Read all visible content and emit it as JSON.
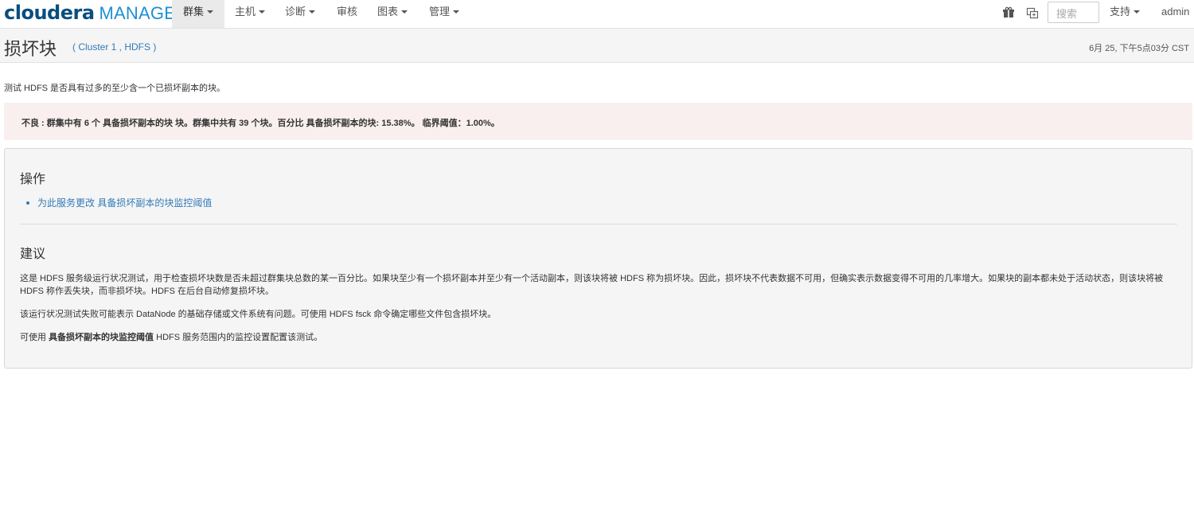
{
  "logo": {
    "brand": "cloudera",
    "product": "MANAGER"
  },
  "nav": {
    "items": [
      {
        "label": "群集",
        "dropdown": true,
        "active": true
      },
      {
        "label": "主机",
        "dropdown": true
      },
      {
        "label": "诊断",
        "dropdown": true
      },
      {
        "label": "审核",
        "dropdown": false
      },
      {
        "label": "图表",
        "dropdown": true
      },
      {
        "label": "管理",
        "dropdown": true
      }
    ],
    "icons": [
      "gift-icon",
      "parcel-icon"
    ],
    "search_placeholder": "搜索",
    "support_label": "支持",
    "user_label": "admin"
  },
  "page": {
    "title": "损坏块",
    "context": "( Cluster 1 , HDFS )",
    "timestamp": "6月 25, 下午5点03分 CST"
  },
  "description": "测试 HDFS 是否具有过多的至少含一个已损坏副本的块。",
  "alert": {
    "text": "不良 : 群集中有 6 个 具备损坏副本的块 块。群集中共有 39 个块。百分比 具备损坏副本的块: 15.38%。 临界阈值：1.00%。",
    "color": "#f9efef"
  },
  "actions": {
    "heading": "操作",
    "links": [
      "为此服务更改 具备损坏副本的块监控阈值"
    ]
  },
  "advice": {
    "heading": "建议",
    "p1": "这是 HDFS 服务级运行状况测试，用于检查损坏块数是否未超过群集块总数的某一百分比。如果块至少有一个损坏副本并至少有一个活动副本，则该块将被 HDFS 称为损坏块。因此，损坏块不代表数据不可用，但确实表示数据变得不可用的几率增大。如果块的副本都未处于活动状态，则该块将被 HDFS 称作丢失块，而非损坏块。HDFS 在后台自动修复损坏块。",
    "p2": "该运行状况测试失败可能表示 DataNode 的基础存储或文件系统有问题。可使用 HDFS fsck 命令确定哪些文件包含损坏块。",
    "p3_prefix": "可使用",
    "p3_bold": "具备损坏副本的块监控阈值",
    "p3_suffix": "HDFS 服务范围内的监控设置配置该测试。"
  },
  "colors": {
    "brand_dark": "#0a4e80",
    "brand_light": "#1f8fd4",
    "link": "#337ab7"
  }
}
